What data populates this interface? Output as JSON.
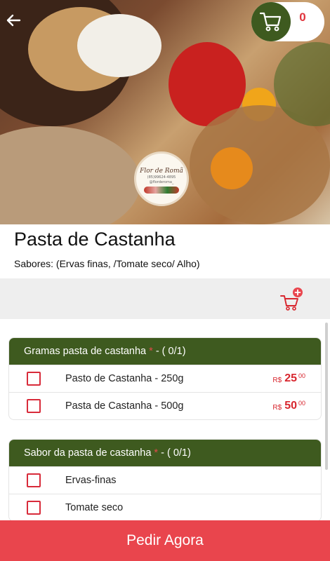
{
  "header": {
    "back_icon": "arrow-left-icon",
    "cart_icon": "shopping-cart-icon",
    "cart_count": "0"
  },
  "hero": {
    "logo_title": "Flor de Romã",
    "logo_phone": "(85)99624-4895",
    "logo_handle": "@florderoma_"
  },
  "product": {
    "title": "Pasta de Castanha",
    "subtitle": "Sabores: (Ervas finas, /Tomate seco/ Alho)",
    "add_cart_icon": "cart-plus-icon"
  },
  "groups": [
    {
      "name": "Gramas pasta de castanha",
      "required_mark": "*",
      "counter": "- ( 0/1)",
      "options": [
        {
          "label": "Pasto de Castanha - 250g",
          "currency": "R$",
          "price_int": "25",
          "price_dec": "00"
        },
        {
          "label": "Pasta de Castanha - 500g",
          "currency": "R$",
          "price_int": "50",
          "price_dec": "00"
        }
      ]
    },
    {
      "name": "Sabor da pasta de castanha",
      "required_mark": "*",
      "counter": "- ( 0/1)",
      "options": [
        {
          "label": "Ervas-finas"
        },
        {
          "label": "Tomate seco"
        }
      ]
    }
  ],
  "cta": {
    "label": "Pedir Agora"
  },
  "colors": {
    "brand_green": "#3e5a1f",
    "accent_red": "#e9454d",
    "price_red": "#d8262e"
  }
}
